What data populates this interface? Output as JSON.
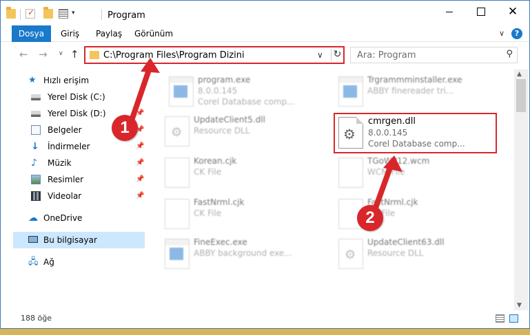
{
  "window": {
    "title": "Program",
    "minimize_glyph": "",
    "maximize_glyph": "",
    "close_glyph": "✕"
  },
  "ribbon": {
    "tabs": [
      {
        "label": "Dosya"
      },
      {
        "label": "Giriş"
      },
      {
        "label": "Paylaş"
      },
      {
        "label": "Görünüm"
      }
    ],
    "help": "?",
    "expand": "∨"
  },
  "nav": {
    "back": "←",
    "forward": "→",
    "recent": "∨",
    "up": "↑",
    "address": "C:\\Program Files\\Program Dizini",
    "address_dropdown": "∨",
    "refresh": "↻",
    "search_placeholder": "Ara: Program",
    "search_glyph": "⚲"
  },
  "sidebar": {
    "items": [
      {
        "label": "Hızlı erişim",
        "icon": "star-icon",
        "glyph": "★",
        "pinned": false
      },
      {
        "label": "Yerel Disk (C:)",
        "icon": "drive-icon",
        "glyph": "",
        "pinned": false
      },
      {
        "label": "Yerel Disk (D:)",
        "icon": "drive-icon",
        "glyph": "",
        "pinned": true
      },
      {
        "label": "Belgeler",
        "icon": "documents-icon",
        "glyph": "",
        "pinned": true
      },
      {
        "label": "İndirmeler",
        "icon": "download-icon",
        "glyph": "↓",
        "pinned": true
      },
      {
        "label": "Müzik",
        "icon": "music-icon",
        "glyph": "♪",
        "pinned": true
      },
      {
        "label": "Resimler",
        "icon": "pictures-icon",
        "glyph": "",
        "pinned": true
      },
      {
        "label": "Videolar",
        "icon": "videos-icon",
        "glyph": "",
        "pinned": true
      },
      {
        "label": "OneDrive",
        "icon": "cloud-icon",
        "glyph": "☁",
        "pinned": false
      },
      {
        "label": "Bu bilgisayar",
        "icon": "computer-icon",
        "glyph": "",
        "pinned": false,
        "selected": true
      },
      {
        "label": "Ağ",
        "icon": "network-icon",
        "glyph": "🖧",
        "pinned": false
      }
    ],
    "pin_glyph": "📌"
  },
  "files": [
    {
      "name": "program.exe",
      "version": "8.0.0.145",
      "desc": "Corel Database comp...",
      "type": "exe"
    },
    {
      "name": "Trgrammminstaller.exe",
      "version": "ABBY finereader tri...",
      "desc": "",
      "type": "exe"
    },
    {
      "name": "UpdateClient5.dll",
      "version": "Resource DLL",
      "desc": "",
      "type": "dll"
    },
    {
      "name": "Korean.cjk",
      "version": "CK File",
      "desc": "",
      "type": "doc"
    },
    {
      "name": "TGoWP12.wcm",
      "version": "WCM File",
      "desc": "",
      "type": "doc"
    },
    {
      "name": "FastNrml.cjk",
      "version": "CK File",
      "desc": "",
      "type": "doc"
    },
    {
      "name": "FastNrml.cjk",
      "version": "CK File",
      "desc": "",
      "type": "doc"
    },
    {
      "name": "FineExec.exe",
      "version": "ABBY background exe...",
      "desc": "",
      "type": "exe"
    },
    {
      "name": "UpdateClient63.dll",
      "version": "Resource DLL",
      "desc": "",
      "type": "dll"
    }
  ],
  "highlighted_file": {
    "name": "cmrgen.dll",
    "version": "8.0.0.145",
    "desc": "Corel Database comp..."
  },
  "status": {
    "count": "188 öğe"
  },
  "annotations": {
    "step1": "1",
    "step2": "2",
    "accent": "#d9262b"
  },
  "colors": {
    "accent_blue": "#1979ca",
    "selection": "#cce8ff",
    "highlight_red": "#d9262b"
  }
}
